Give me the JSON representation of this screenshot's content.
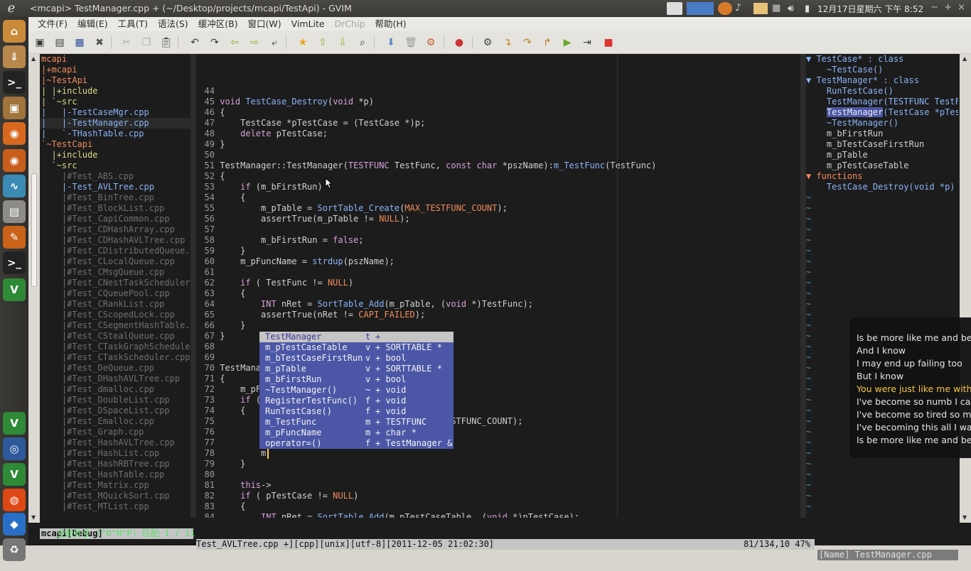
{
  "window": {
    "title": "<mcapi> TestManager.cpp + (~/Desktop/projects/mcapi/TestApi) - GVIM",
    "clock": "12月17日星期六 下午 8:52"
  },
  "menu": [
    {
      "label": "文件(F)",
      "enabled": true
    },
    {
      "label": "编辑(E)",
      "enabled": true
    },
    {
      "label": "工具(T)",
      "enabled": true
    },
    {
      "label": "语法(S)",
      "enabled": true
    },
    {
      "label": "缓冲区(B)",
      "enabled": true
    },
    {
      "label": "窗口(W)",
      "enabled": true
    },
    {
      "label": "VimLite",
      "enabled": true
    },
    {
      "label": "DrChip",
      "enabled": false
    },
    {
      "label": "帮助(H)",
      "enabled": true
    }
  ],
  "tree": [
    {
      "text": "mcapi",
      "color": "#f28b5b"
    },
    {
      "text": "|+mcapi",
      "color": "#f28b5b"
    },
    {
      "text": "|~TestApi",
      "color": "#f28b5b"
    },
    {
      "text": "| |+include",
      "color": "#d7d78a"
    },
    {
      "text": "| `~src",
      "color": "#d7d78a"
    },
    {
      "text": "|   |-TestCaseMgr.cpp",
      "color": "#8ab4f8"
    },
    {
      "text": "|   |-TestManager.cpp",
      "color": "#8ab4f8"
    },
    {
      "text": "|   `-THashTable.cpp",
      "color": "#8ab4f8"
    },
    {
      "text": "`~TestCapi",
      "color": "#f28b5b"
    },
    {
      "text": "  |+include",
      "color": "#d7d78a"
    },
    {
      "text": "  `~src",
      "color": "#d7d78a"
    },
    {
      "text": "    |#Test_ABS.cpp",
      "color": "#6f6f6f"
    },
    {
      "text": "    |-Test_AVLTree.cpp",
      "color": "#8ab4f8"
    },
    {
      "text": "    |#Test_BinTree.cpp",
      "color": "#6f6f6f"
    },
    {
      "text": "    |#Test_BlockList.cpp",
      "color": "#6f6f6f"
    },
    {
      "text": "    |#Test_CapiCommon.cpp",
      "color": "#6f6f6f"
    },
    {
      "text": "    |#Test_CDHashArray.cpp",
      "color": "#6f6f6f"
    },
    {
      "text": "    |#Test_CDHashAVLTree.cpp",
      "color": "#6f6f6f"
    },
    {
      "text": "    |#Test_CDistributedQueue.c",
      "color": "#6f6f6f"
    },
    {
      "text": "    |#Test_CLocalQueue.cpp",
      "color": "#6f6f6f"
    },
    {
      "text": "    |#Test_CMsgQueue.cpp",
      "color": "#6f6f6f"
    },
    {
      "text": "    |#Test_CNestTaskScheduler.",
      "color": "#6f6f6f"
    },
    {
      "text": "    |#Test_CQueuePool.cpp",
      "color": "#6f6f6f"
    },
    {
      "text": "    |#Test_CRankList.cpp",
      "color": "#6f6f6f"
    },
    {
      "text": "    |#Test_CScopedLock.cpp",
      "color": "#6f6f6f"
    },
    {
      "text": "    |#Test_CSegmentHashTable.c",
      "color": "#6f6f6f"
    },
    {
      "text": "    |#Test_CStealQueue.cpp",
      "color": "#6f6f6f"
    },
    {
      "text": "    |#Test_CTaskGraphScheduler",
      "color": "#6f6f6f"
    },
    {
      "text": "    |#Test_CTaskScheduler.cpp",
      "color": "#6f6f6f"
    },
    {
      "text": "    |#Test_DeQueue.cpp",
      "color": "#6f6f6f"
    },
    {
      "text": "    |#Test_DHashAVLTree.cpp",
      "color": "#6f6f6f"
    },
    {
      "text": "    |#Test_dmalloc.cpp",
      "color": "#6f6f6f"
    },
    {
      "text": "    |#Test_DoubleList.cpp",
      "color": "#6f6f6f"
    },
    {
      "text": "    |#Test_DSpaceList.cpp",
      "color": "#6f6f6f"
    },
    {
      "text": "    |#Test_Emalloc.cpp",
      "color": "#6f6f6f"
    },
    {
      "text": "    |#Test_Graph.cpp",
      "color": "#6f6f6f"
    },
    {
      "text": "    |#Test_HashAVLTree.cpp",
      "color": "#6f6f6f"
    },
    {
      "text": "    |#Test_HashList.cpp",
      "color": "#6f6f6f"
    },
    {
      "text": "    |#Test_HashRBTree.cpp",
      "color": "#6f6f6f"
    },
    {
      "text": "    |#Test_HashTable.cpp",
      "color": "#6f6f6f"
    },
    {
      "text": "    |#Test_Matrix.cpp",
      "color": "#6f6f6f"
    },
    {
      "text": "    |#Test_MQuickSort.cpp",
      "color": "#6f6f6f"
    },
    {
      "text": "    |#Test_MTList.cpp",
      "color": "#6f6f6f"
    }
  ],
  "code": [
    {
      "n": "44",
      "t": ""
    },
    {
      "n": "45",
      "t": "void TestCase_Destroy(void *p)"
    },
    {
      "n": "46",
      "t": "{"
    },
    {
      "n": "47",
      "t": "    TestCase *pTestCase = (TestCase *)p;"
    },
    {
      "n": "48",
      "t": "    delete pTestCase;"
    },
    {
      "n": "49",
      "t": "}"
    },
    {
      "n": "50",
      "t": ""
    },
    {
      "n": "51",
      "t": "TestManager::TestManager(TESTFUNC TestFunc, const char *pszName):m_TestFunc(TestFunc)"
    },
    {
      "n": "52",
      "t": "{"
    },
    {
      "n": "53",
      "t": "    if (m_bFirstRun)"
    },
    {
      "n": "54",
      "t": "    {"
    },
    {
      "n": "55",
      "t": "        m_pTable = SortTable_Create(MAX_TESTFUNC_COUNT);"
    },
    {
      "n": "56",
      "t": "        assertTrue(m_pTable != NULL);"
    },
    {
      "n": "57",
      "t": ""
    },
    {
      "n": "58",
      "t": "        m_bFirstRun = false;"
    },
    {
      "n": "59",
      "t": "    }"
    },
    {
      "n": "60",
      "t": "    m_pFuncName = strdup(pszName);"
    },
    {
      "n": "61",
      "t": ""
    },
    {
      "n": "62",
      "t": "    if ( TestFunc != NULL)"
    },
    {
      "n": "63",
      "t": "    {"
    },
    {
      "n": "64",
      "t": "        INT nRet = SortTable_Add(m_pTable, (void *)TestFunc);"
    },
    {
      "n": "65",
      "t": "        assertTrue(nRet != CAPI_FAILED);"
    },
    {
      "n": "66",
      "t": "    }"
    },
    {
      "n": "67",
      "t": "}"
    },
    {
      "n": "68",
      "t": ""
    },
    {
      "n": "69",
      "t": ""
    },
    {
      "n": "70",
      "t": "TestManag"
    },
    {
      "n": "71",
      "t": "{"
    },
    {
      "n": "72",
      "t": "    m_pFu"
    },
    {
      "n": "73",
      "t": "    if (m"
    },
    {
      "n": "74",
      "t": "    {"
    },
    {
      "n": "75",
      "t": "        m                                  TESTFUNC_COUNT);"
    },
    {
      "n": "76",
      "t": "        a"
    },
    {
      "n": "77",
      "t": ""
    },
    {
      "n": "78",
      "t": "        m"
    },
    {
      "n": "79",
      "t": "    }"
    },
    {
      "n": "80",
      "t": ""
    },
    {
      "n": "81",
      "t": "    this->"
    },
    {
      "n": "82",
      "t": "    if ( pTestCase != NULL)"
    },
    {
      "n": "83",
      "t": "    {"
    },
    {
      "n": "84",
      "t": "        INT nRet = SortTable_Add(m_pTestCaseTable, (void *)pTestCase);"
    },
    {
      "n": "85",
      "t": "        assertTrue(nRet != CAPI_FAILED);"
    },
    {
      "n": "86",
      "t": "    }"
    }
  ],
  "tags": [
    {
      "text": "▼ TestCase* : class",
      "color": "#8ab4f8",
      "hl": false
    },
    {
      "text": "    ~TestCase()",
      "color": "#8ab4f8",
      "hl": false
    },
    {
      "text": "▼ TestManager* : class",
      "color": "#8ab4f8",
      "hl": false
    },
    {
      "text": "    RunTestCase()",
      "color": "#8ab4f8",
      "hl": false
    },
    {
      "text": "    TestManager(TESTFUNC TestF",
      "color": "#8ab4f8",
      "hl": false
    },
    {
      "text": "    TestManager(TestCase *pTes",
      "color": "#8ab4f8",
      "hl": true
    },
    {
      "text": "    ~TestManager()",
      "color": "#8ab4f8",
      "hl": false
    },
    {
      "text": "    m_bFirstRun",
      "color": "#d0d0d0",
      "hl": false
    },
    {
      "text": "    m_bTestCaseFirstRun",
      "color": "#d0d0d0",
      "hl": false
    },
    {
      "text": "    m_pTable",
      "color": "#d0d0d0",
      "hl": false
    },
    {
      "text": "    m_pTestCaseTable",
      "color": "#d0d0d0",
      "hl": false
    },
    {
      "text": "▼ functions",
      "color": "#f28b5b",
      "hl": false
    },
    {
      "text": "    TestCase_Destroy(void *p)",
      "color": "#8ab4f8",
      "hl": false
    }
  ],
  "tilde": "~",
  "popup": [
    {
      "name": "TestManager",
      "kind": "t",
      "type": "+",
      "selected": true
    },
    {
      "name": "m_pTestCaseTable",
      "kind": "v",
      "type": "+ SORTTABLE *",
      "selected": false
    },
    {
      "name": "m_bTestCaseFirstRun",
      "kind": "v",
      "type": "+ bool",
      "selected": false
    },
    {
      "name": "m_pTable",
      "kind": "v",
      "type": "+ SORTTABLE *",
      "selected": false
    },
    {
      "name": "m_bFirstRun",
      "kind": "v",
      "type": "+ bool",
      "selected": false
    },
    {
      "name": "~TestManager()",
      "kind": "~",
      "type": "+ void",
      "selected": false
    },
    {
      "name": "RegisterTestFunc()",
      "kind": "f",
      "type": "+ void",
      "selected": false
    },
    {
      "name": "RunTestCase()",
      "kind": "f",
      "type": "+ void",
      "selected": false
    },
    {
      "name": "m_TestFunc",
      "kind": "m",
      "type": "+ TESTFUNC",
      "selected": false
    },
    {
      "name": "m_pFuncName",
      "kind": "m",
      "type": "+ char *",
      "selected": false
    },
    {
      "name": "operator=()",
      "kind": "f",
      "type": "+ TestManager &",
      "selected": false
    }
  ],
  "status": {
    "left": "mcapi[Debug]",
    "middle": "Test_AVLTree.cpp +][cpp][unix][utf-8][2011-12-05 21:02:30]",
    "position": "81/134,10 47%",
    "right": "[Name] TestManager.cpp"
  },
  "cmdline": "-- 全能补全 (^O^N^P) 匹配 1 / 11",
  "lyrics": [
    {
      "text": "Is be more like me and be",
      "current": false
    },
    {
      "text": "And I know",
      "current": false
    },
    {
      "text": "I may end up failing too",
      "current": false
    },
    {
      "text": "But I know",
      "current": false
    },
    {
      "text": "You were just like me with",
      "current": true
    },
    {
      "text": "I've become so numb I can",
      "current": false
    },
    {
      "text": "I've become so tired so mu",
      "current": false
    },
    {
      "text": "I've becoming this all I wan",
      "current": false
    },
    {
      "text": "Is be more like me and be",
      "current": false
    }
  ],
  "launcher": [
    {
      "name": "dash-home-icon",
      "glyph": "⌂",
      "bg": "#c98a3a"
    },
    {
      "name": "download-icon",
      "glyph": "⇓",
      "bg": "#b8874b"
    },
    {
      "name": "terminal-icon",
      "glyph": ">_",
      "bg": "#222"
    },
    {
      "name": "package-icon",
      "glyph": "▣",
      "bg": "#a0743a"
    },
    {
      "name": "firefox-icon",
      "glyph": "◉",
      "bg": "#d9681f"
    },
    {
      "name": "firefox-alt-icon",
      "glyph": "◉",
      "bg": "#c85e1c"
    },
    {
      "name": "system-monitor-icon",
      "glyph": "∿",
      "bg": "#3b8bb5"
    },
    {
      "name": "file-cabinet-icon",
      "glyph": "▤",
      "bg": "#8d8b85"
    },
    {
      "name": "tools-icon",
      "glyph": "✎",
      "bg": "#c9631a"
    },
    {
      "name": "terminal-2-icon",
      "glyph": ">_",
      "bg": "#222"
    },
    {
      "name": "vim-icon",
      "glyph": "V",
      "bg": "#2f8a37"
    },
    {
      "name": "vim-launcher-icon",
      "glyph": "V",
      "bg": "#2f8a37"
    },
    {
      "name": "globe-icon",
      "glyph": "◎",
      "bg": "#2e5a9b"
    },
    {
      "name": "vim-lite-icon",
      "glyph": "V",
      "bg": "#2f8a37"
    },
    {
      "name": "ubuntu-icon",
      "glyph": "◍",
      "bg": "#dd4814"
    },
    {
      "name": "blocks-icon",
      "glyph": "◆",
      "bg": "#2a6fc7"
    },
    {
      "name": "trash-icon",
      "glyph": "♻",
      "bg": "#777"
    }
  ]
}
